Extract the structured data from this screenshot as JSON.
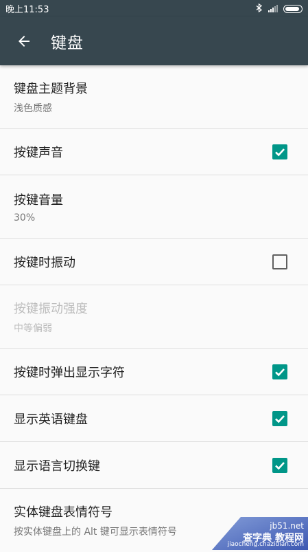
{
  "status_bar": {
    "time": "晚上11:53",
    "icons": [
      "bluetooth-icon",
      "signal-icon",
      "battery-icon"
    ]
  },
  "app_bar": {
    "title": "键盘",
    "back_icon": "arrow-left-icon",
    "background": "#37474f"
  },
  "colors": {
    "accent": "#009688",
    "divider": "#dedede",
    "disabled_text": "#bdbdbd"
  },
  "settings": [
    {
      "title": "键盘主题背景",
      "summary": "浅色质感"
    },
    {
      "title": "按键声音",
      "checked": true
    },
    {
      "title": "按键音量",
      "summary": "30%"
    },
    {
      "title": "按键时振动",
      "checked": false
    },
    {
      "title": "按键振动强度",
      "summary": "中等偏弱",
      "enabled": false
    },
    {
      "title": "按键时弹出显示字符",
      "checked": true
    },
    {
      "title": "显示英语键盘",
      "checked": true
    },
    {
      "title": "显示语言切换键",
      "checked": true
    },
    {
      "title": "实体键盘表情符号",
      "summary": "按实体键盘上的 Alt 键可显示表情符号"
    }
  ],
  "watermark": {
    "line1": "jb51.net",
    "line2": "查字典 教程网",
    "line3": "jiaocheng.chazidian.com"
  }
}
